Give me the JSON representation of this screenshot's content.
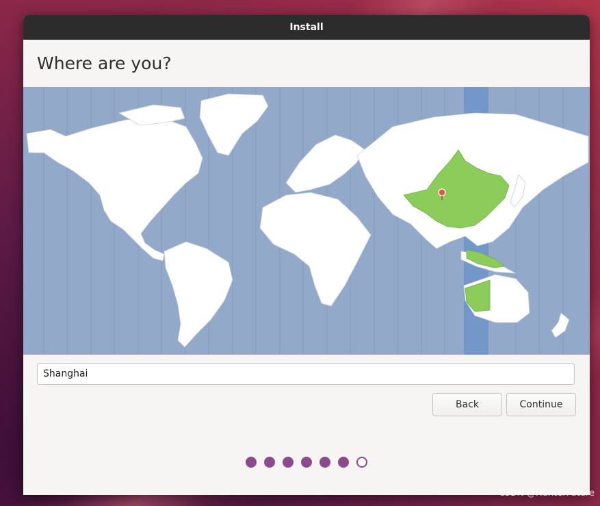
{
  "window": {
    "title": "Install"
  },
  "page": {
    "heading": "Where are you?"
  },
  "map": {
    "selected_region": "China",
    "land_color": "#ffffff",
    "ocean_color": "#93a9c9",
    "timezone_band_color": "#7397c8",
    "selected_color": "#8bcc5b",
    "pin_color": "#e2554e",
    "pin_icon": "map-pin-icon"
  },
  "location": {
    "value": "Shanghai"
  },
  "buttons": {
    "back": "Back",
    "continue": "Continue"
  },
  "progress": {
    "total_steps": 7,
    "completed_steps": 6
  },
  "watermark": "CSDN @HunterFuture"
}
